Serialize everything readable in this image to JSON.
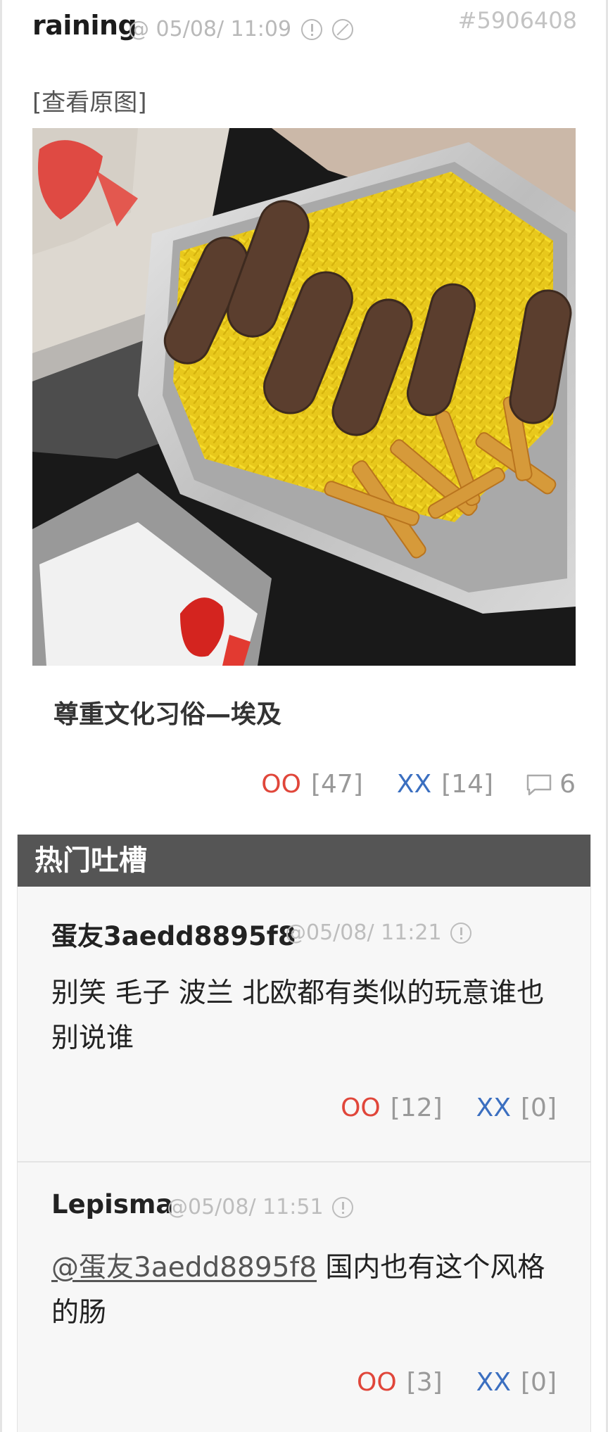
{
  "post": {
    "author": "raining",
    "meta_time": "@ 05/08/ 11:09",
    "id": "#5906408",
    "view_original": "[查看原图]",
    "caption": "尊重文化习俗—埃及",
    "oo_label": "OO",
    "oo_count": "[47]",
    "xx_label": "XX",
    "xx_count": "[14]",
    "comment_count": "6"
  },
  "hot_comments": {
    "title": "热门吐槽",
    "items": [
      {
        "author": "蛋友3aedd8895f8",
        "time": "@05/08/ 11:21",
        "text": "别笑 毛子 波兰 北欧都有类似的玩意谁也别说谁",
        "oo_label": "OO",
        "oo_count": "[12]",
        "xx_label": "XX",
        "xx_count": "[0]"
      },
      {
        "author": "Lepisma",
        "time": "@05/08/ 11:51",
        "mention": "@蛋友3aedd8895f8",
        "text": " 国内也有这个风格的肠",
        "oo_label": "OO",
        "oo_count": "[3]",
        "xx_label": "XX",
        "xx_count": "[0]"
      }
    ]
  },
  "colors": {
    "oo": "#e0463a",
    "xx": "#3b6fc0",
    "hot_header_bg": "#555555"
  }
}
